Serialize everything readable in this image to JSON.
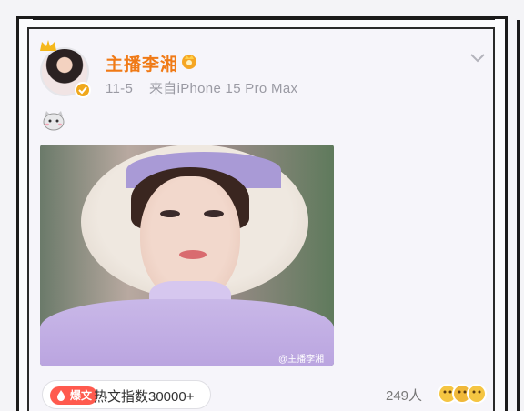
{
  "post": {
    "username": "主播李湘",
    "date": "11-5",
    "source": "来自iPhone 15 Pro Max",
    "photo_watermark": "@主播李湘"
  },
  "footer": {
    "hot_tag": "爆文",
    "heat_index": "热文指数30000+",
    "readers": "249人"
  },
  "icons": [
    "crown-icon",
    "verify-icon",
    "vip-badge-icon",
    "chevron-down-icon",
    "cat-emoji-icon",
    "flame-icon",
    "reaction-avatars-icon"
  ],
  "colors": {
    "username": "#f07a16",
    "meta": "#9a9aa3",
    "hot_tag": "#ff5a4e"
  }
}
